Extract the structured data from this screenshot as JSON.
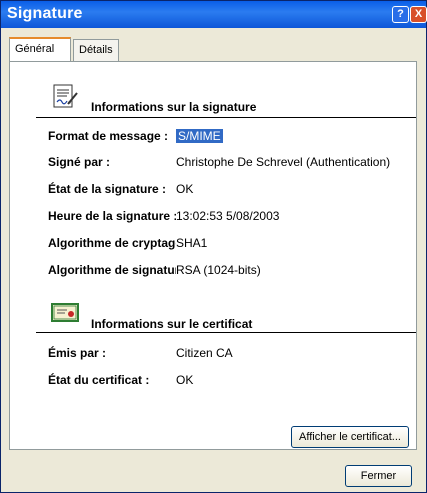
{
  "window": {
    "title": "Signature"
  },
  "titlebar_buttons": {
    "help": "?",
    "close": "X"
  },
  "tabs": [
    {
      "label": "Général",
      "active": true
    },
    {
      "label": "Détails",
      "active": false
    }
  ],
  "signature_section": {
    "title": "Informations sur la signature",
    "rows": [
      {
        "label": "Format de message :",
        "value": "S/MIME"
      },
      {
        "label": "Signé par :",
        "value": "Christophe De Schrevel (Authentication)"
      },
      {
        "label": "État de la signature :",
        "value": "OK"
      },
      {
        "label": "Heure de la signature :",
        "value": "13:02:53 5/08/2003"
      },
      {
        "label": "Algorithme de cryptage :",
        "value": "SHA1"
      },
      {
        "label": "Algorithme de signature :",
        "value": "RSA (1024-bits)"
      }
    ]
  },
  "certificate_section": {
    "title": "Informations sur le certificat",
    "rows": [
      {
        "label": "Émis par :",
        "value": "Citizen CA"
      },
      {
        "label": "État du certificat :",
        "value": "OK"
      }
    ]
  },
  "buttons": {
    "view_certificate": "Afficher le certificat...",
    "close": "Fermer"
  },
  "colors": {
    "title_bar": "#0a5ee8",
    "selection": "#316ac5",
    "active_tab_accent": "#e68b2c"
  },
  "icons": {
    "signature": "document-signature-icon",
    "certificate": "certificate-icon"
  }
}
